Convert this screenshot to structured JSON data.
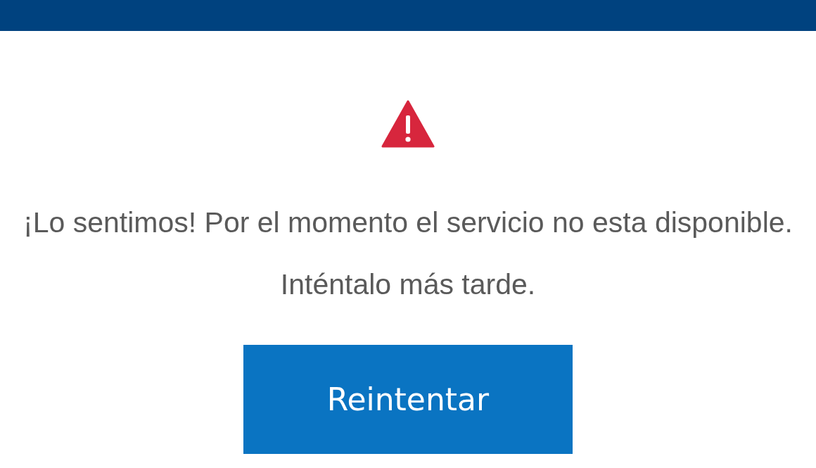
{
  "header": {
    "kind": "bar"
  },
  "alert": {
    "kind": "warning",
    "message": "¡Lo sentimos! Por el momento el servicio no esta disponible. Inténtalo más tarde."
  },
  "buttons": [
    {
      "label": "Reintentar"
    }
  ]
}
